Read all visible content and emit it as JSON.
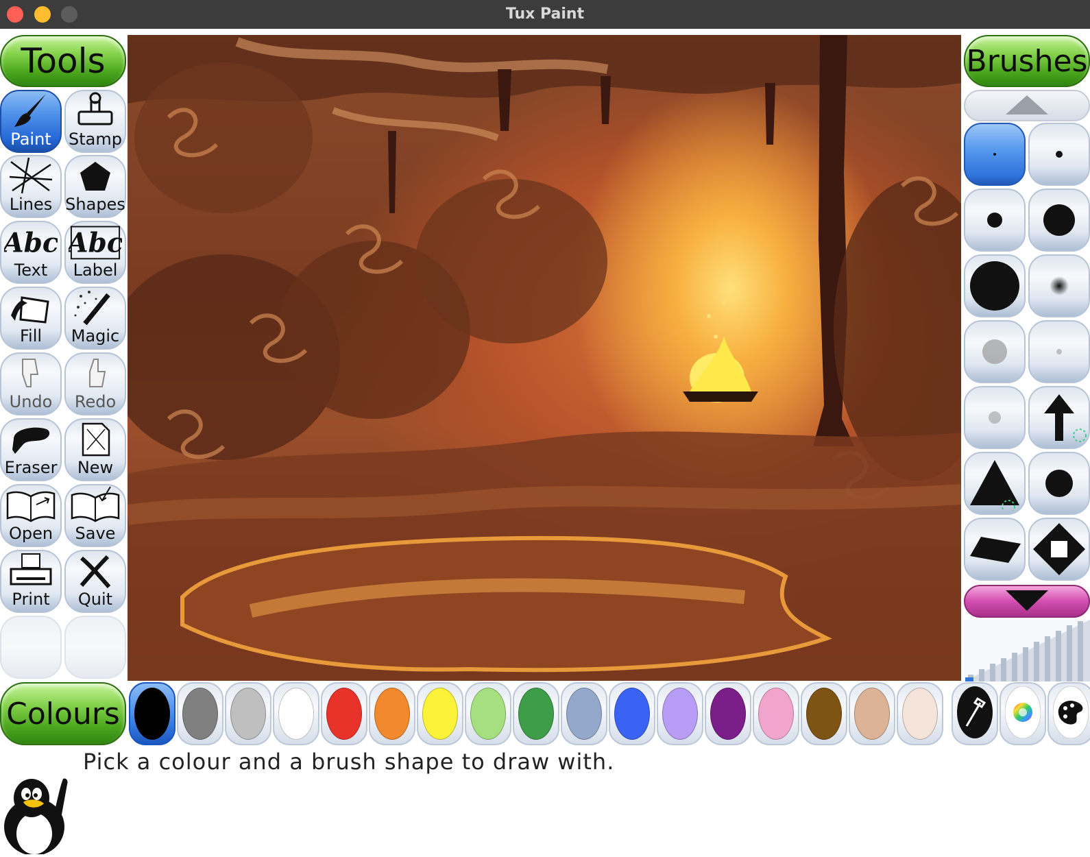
{
  "window": {
    "title": "Tux Paint"
  },
  "tools": {
    "title": "Tools",
    "items": [
      {
        "label": "Paint",
        "icon": "paintbrush-icon",
        "active": true
      },
      {
        "label": "Stamp",
        "icon": "stamp-icon"
      },
      {
        "label": "Lines",
        "icon": "lines-icon"
      },
      {
        "label": "Shapes",
        "icon": "pentagon-icon"
      },
      {
        "label": "Text",
        "icon": "text-abc-icon"
      },
      {
        "label": "Label",
        "icon": "label-abc-icon"
      },
      {
        "label": "Fill",
        "icon": "paint-bucket-icon"
      },
      {
        "label": "Magic",
        "icon": "magic-wand-icon"
      },
      {
        "label": "Undo",
        "icon": "thumbs-down-icon",
        "disabled": true
      },
      {
        "label": "Redo",
        "icon": "thumbs-up-icon",
        "disabled": true
      },
      {
        "label": "Eraser",
        "icon": "eraser-icon"
      },
      {
        "label": "New",
        "icon": "new-page-icon"
      },
      {
        "label": "Open",
        "icon": "open-book-icon"
      },
      {
        "label": "Save",
        "icon": "save-book-icon"
      },
      {
        "label": "Print",
        "icon": "printer-icon"
      },
      {
        "label": "Quit",
        "icon": "quit-x-icon"
      }
    ]
  },
  "brushes": {
    "title": "Brushes",
    "scroll_up_icon": "triangle-up-icon",
    "scroll_down_icon": "triangle-down-icon"
  },
  "colours": {
    "title": "Colours",
    "swatches": [
      "#000000",
      "#808080",
      "#bfbfbf",
      "#ffffff",
      "#e8332a",
      "#f2892e",
      "#fbf23a",
      "#a6df80",
      "#3d9d48",
      "#93a8cb",
      "#3a63f3",
      "#b79df5",
      "#7c1e8a",
      "#f2a5cc",
      "#7d5414",
      "#dcb396",
      "#f4e4da"
    ],
    "selected": "#000000",
    "extra_buttons": [
      "eyedropper-icon",
      "colour-wheel-icon",
      "palette-icon"
    ]
  },
  "status": {
    "message": "Pick a colour and a brush shape to draw with."
  },
  "mascot": {
    "icon": "tux-penguin-icon"
  }
}
